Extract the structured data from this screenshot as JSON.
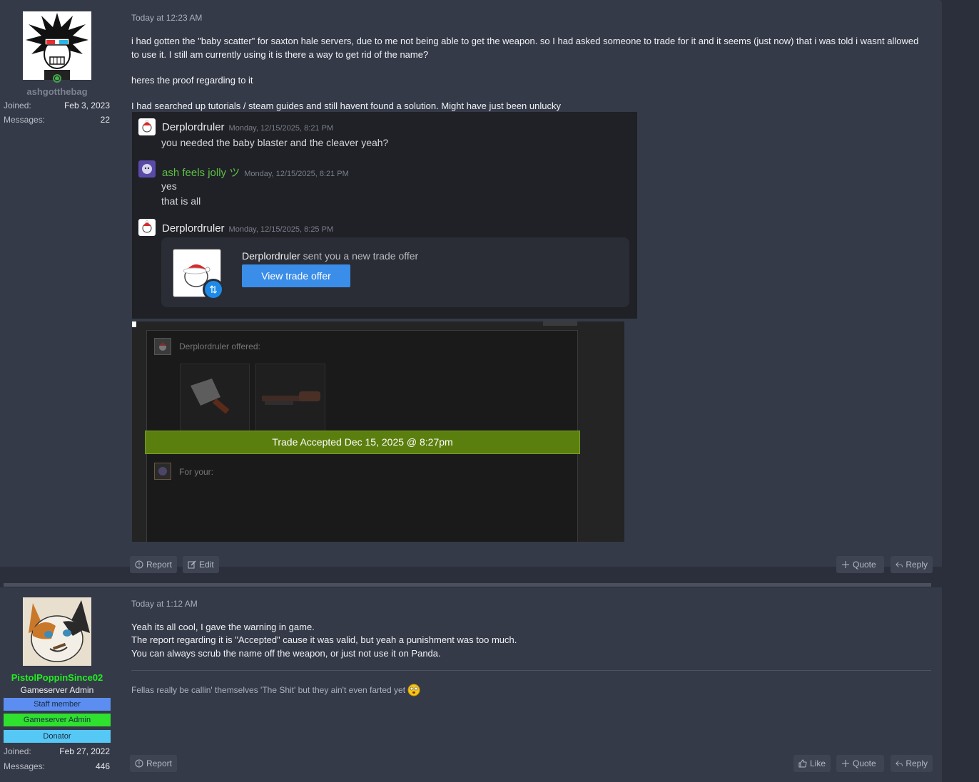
{
  "post1": {
    "user": {
      "name": "ashgotthebag",
      "joined_label": "Joined:",
      "joined": "Feb 3, 2023",
      "messages_label": "Messages:",
      "messages": "22"
    },
    "timestamp": "Today at 12:23 AM",
    "paragraphs": [
      "i had gotten the \"baby scatter\" for saxton hale servers, due to me not being able to get the weapon. so I had asked someone to trade for it and it seems (just now) that i was told i wasnt allowed to use it. I still am currently using it is there a way to get rid of the name?",
      "heres the proof regarding to it",
      "I had searched up tutorials / steam guides and still havent found a solution. Might have just been unlucky"
    ],
    "discord": {
      "msg1": {
        "author": "Derplordruler",
        "time": "Monday, 12/15/2025, 8:21 PM",
        "text": "you needed the baby blaster and the cleaver yeah?"
      },
      "msg2": {
        "author": "ash feels jolly ツ",
        "time": "Monday, 12/15/2025, 8:21 PM",
        "line1": "yes",
        "line2": "that is all"
      },
      "msg3": {
        "author": "Derplordruler",
        "time": "Monday, 12/15/2025, 8:25 PM"
      },
      "trade": {
        "sender": "Derplordruler",
        "text": " sent you a new trade offer",
        "button": "View trade offer"
      }
    },
    "steam": {
      "offered_label": "Derplordruler offered:",
      "accepted": "Trade Accepted Dec 15, 2025 @ 8:27pm",
      "for_label": "For your:"
    },
    "actions": {
      "report": "Report",
      "edit": "Edit",
      "quote": "Quote",
      "reply": "Reply"
    }
  },
  "post2": {
    "user": {
      "name": "PistolPoppinSince02",
      "title": "Gameserver Admin",
      "banners": [
        "Staff member",
        "Gameserver Admin",
        "Donator"
      ],
      "joined_label": "Joined:",
      "joined": "Feb 27, 2022",
      "messages_label": "Messages:",
      "messages": "446"
    },
    "timestamp": "Today at 1:12 AM",
    "lines": [
      "Yeah its all cool, I gave the warning in game.",
      "The report regarding it is \"Accepted\" cause it was valid, but yeah a punishment was too much.",
      "You can always scrub the name off the weapon, or just not use it on Panda."
    ],
    "signature": "Fellas really be callin' themselves 'The Shit' but they ain't even farted yet",
    "actions": {
      "report": "Report",
      "like": "Like",
      "quote": "Quote",
      "reply": "Reply"
    }
  },
  "colors": {
    "banner_staff": "#5b8ef0",
    "banner_admin": "#2fe02f",
    "banner_donator": "#55c8f5",
    "admin_name": "#22ee22",
    "trade_button": "#3a8de8",
    "accepted_bar": "#5b7f0e"
  }
}
